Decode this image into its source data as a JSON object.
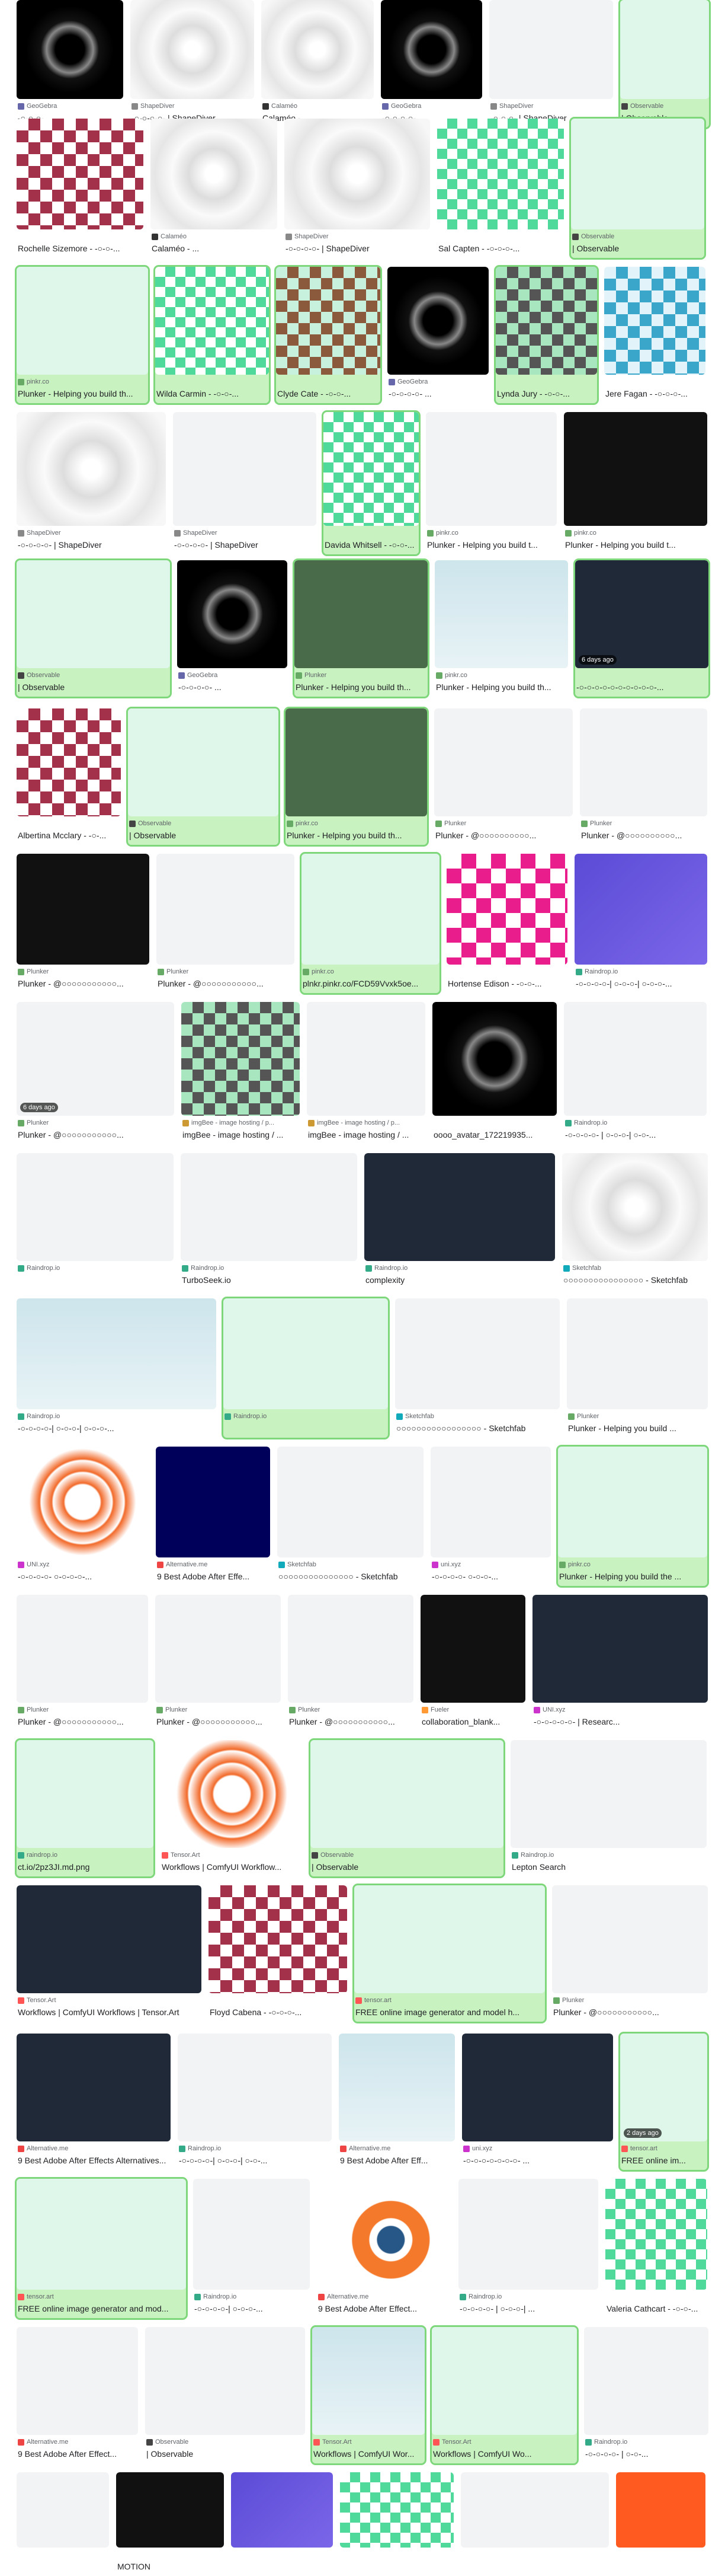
{
  "colors": {
    "selected_bg": "#c8f2c0",
    "selected_border": "#7ed77a",
    "text": "#202124",
    "muted": "#5f6368"
  },
  "rows": [
    {
      "cards": [
        {
          "src": "GeoGebra",
          "title": "-○-○-○- ...",
          "fav": "#66a",
          "cls": "raddk",
          "sel": false
        },
        {
          "src": "ShapeDiver",
          "title": "-○-○-○-○- | ShapeDiver",
          "fav": "#888",
          "cls": "rad",
          "sel": false
        },
        {
          "src": "Calaméo",
          "title": "Calaméo - ...",
          "fav": "#333",
          "cls": "rad",
          "sel": false
        },
        {
          "src": "GeoGebra",
          "title": "-○-○-○-○- ...",
          "fav": "#66a",
          "cls": "raddk",
          "sel": false
        },
        {
          "src": "ShapeDiver",
          "title": "-○-○-○- | ShapeDiver",
          "fav": "#888",
          "cls": "lt",
          "sel": false
        },
        {
          "src": "Observable",
          "title": "| Observable",
          "fav": "#444",
          "cls": "mint",
          "sel": true
        }
      ]
    },
    {
      "cards": [
        {
          "src": "",
          "title": "Rochelle Sizemore - -○-○-...",
          "fav": "",
          "cls": "quilt-red",
          "sel": false
        },
        {
          "src": "Calaméo",
          "title": "Calaméo - ...",
          "fav": "#333",
          "cls": "rad",
          "sel": false
        },
        {
          "src": "ShapeDiver",
          "title": "-○-○-○-○- | ShapeDiver",
          "fav": "#888",
          "cls": "rad",
          "sel": false
        },
        {
          "src": "",
          "title": "Sal Capten - -○-○-○-...",
          "fav": "",
          "cls": "quilt-green",
          "sel": false
        },
        {
          "src": "Observable",
          "title": "| Observable",
          "fav": "#444",
          "cls": "mint",
          "sel": true
        }
      ]
    },
    {
      "cards": [
        {
          "src": "pinkr.co",
          "title": "Plunker - Helping you build th...",
          "fav": "#6a6",
          "cls": "mint",
          "sel": true
        },
        {
          "src": "",
          "title": "Wilda Carmin - -○-○-...",
          "fav": "",
          "cls": "quilt-green",
          "sel": true
        },
        {
          "src": "",
          "title": "Clyde Cate - -○-○-...",
          "fav": "",
          "cls": "quilt-brown",
          "sel": true
        },
        {
          "src": "GeoGebra",
          "title": "-○-○-○-○- ...",
          "fav": "#66a",
          "cls": "raddk",
          "sel": false
        },
        {
          "src": "",
          "title": "Lynda Jury - -○-○-...",
          "fav": "",
          "cls": "quilt-grey",
          "sel": true
        },
        {
          "src": "",
          "title": "Jere Fagan - -○-○-○-...",
          "fav": "",
          "cls": "quilt-teal",
          "sel": false
        }
      ]
    },
    {
      "cards": [
        {
          "src": "ShapeDiver",
          "title": "-○-○-○-○- | ShapeDiver",
          "fav": "#888",
          "cls": "rad",
          "sel": false
        },
        {
          "src": "ShapeDiver",
          "title": "-○-○-○-○- | ShapeDiver",
          "fav": "#888",
          "cls": "lt",
          "sel": false
        },
        {
          "src": "",
          "title": "Davida Whitsell - -○-○-...",
          "fav": "",
          "cls": "quilt-green",
          "sel": true
        },
        {
          "src": "pinkr.co",
          "title": "Plunker - Helping you build t...",
          "fav": "#6a6",
          "cls": "lt",
          "sel": false
        },
        {
          "src": "pinkr.co",
          "title": "Plunker - Helping you build t...",
          "fav": "#6a6",
          "cls": "dk",
          "sel": false
        }
      ]
    },
    {
      "cards": [
        {
          "src": "Observable",
          "title": "| Observable",
          "fav": "#444",
          "cls": "mint",
          "sel": true
        },
        {
          "src": "GeoGebra",
          "title": "-○-○-○-○- ...",
          "fav": "#66a",
          "cls": "raddk",
          "sel": false
        },
        {
          "src": "Plunker",
          "title": "Plunker - Helping you build th...",
          "fav": "#6a6",
          "cls": "green-dk",
          "sel": true
        },
        {
          "src": "pinkr.co",
          "title": "Plunker - Helping you build th...",
          "fav": "#6a6",
          "cls": "sky",
          "sel": false
        },
        {
          "src": "",
          "title": "-○-○-○-○-○-○-○-○-○-○-...",
          "fav": "",
          "cls": "navy",
          "sel": true,
          "ago": "6 days ago"
        }
      ]
    },
    {
      "cards": [
        {
          "src": "",
          "title": "Albertina Mcclary - -○-...",
          "fav": "",
          "cls": "quilt-red",
          "sel": false
        },
        {
          "src": "Observable",
          "title": "| Observable",
          "fav": "#444",
          "cls": "mint",
          "sel": true
        },
        {
          "src": "pinkr.co",
          "title": "Plunker - Helping you build th...",
          "fav": "#6a6",
          "cls": "green-dk",
          "sel": true
        },
        {
          "src": "Plunker",
          "title": "Plunker - @○○○○○○○○○○...",
          "fav": "#6a6",
          "cls": "lt",
          "sel": false
        },
        {
          "src": "Plunker",
          "title": "Plunker - @○○○○○○○○○○...",
          "fav": "#6a6",
          "cls": "lt",
          "sel": false
        }
      ]
    },
    {
      "cards": [
        {
          "src": "Plunker",
          "title": "Plunker - @○○○○○○○○○○○...",
          "fav": "#6a6",
          "cls": "dk",
          "sel": false
        },
        {
          "src": "Plunker",
          "title": "Plunker - @○○○○○○○○○○○...",
          "fav": "#6a6",
          "cls": "lt",
          "sel": false
        },
        {
          "src": "pinkr.co",
          "title": "plnkr.pinkr.co/FCD59Vvxk5oe...",
          "fav": "#6a6",
          "cls": "mint",
          "sel": true
        },
        {
          "src": "",
          "title": "Hortense Edison - -○-○-...",
          "fav": "",
          "cls": "magenta",
          "sel": false
        },
        {
          "src": "Raindrop.io",
          "title": "-○-○-○-○-| ○-○-○-| ○-○-○-...",
          "fav": "#3a8",
          "cls": "purple",
          "sel": false
        }
      ]
    },
    {
      "cards": [
        {
          "src": "Plunker",
          "title": "Plunker - @○○○○○○○○○○○...",
          "fav": "#6a6",
          "cls": "lt",
          "sel": false,
          "ago": "6 days ago"
        },
        {
          "src": "imgBee - image hosting / p...",
          "title": "imgBee - image hosting / ...",
          "fav": "#c93",
          "cls": "quilt-grey",
          "sel": false
        },
        {
          "src": "imgBee - image hosting / p...",
          "title": "imgBee - image hosting / ...",
          "fav": "#c93",
          "cls": "lt",
          "sel": false
        },
        {
          "src": "",
          "title": "oooo_avatar_172219935...",
          "fav": "",
          "cls": "raddk",
          "sel": false
        },
        {
          "src": "Raindrop.io",
          "title": "-○-○-○-○- | ○-○-○-| ○-○-...",
          "fav": "#3a8",
          "cls": "lt",
          "sel": false
        }
      ]
    },
    {
      "cards": [
        {
          "src": "Raindrop.io",
          "title": "",
          "fav": "#3a8",
          "cls": "lt",
          "sel": false
        },
        {
          "src": "Raindrop.io",
          "title": "TurboSeek.io",
          "fav": "#3a8",
          "cls": "lt",
          "sel": false
        },
        {
          "src": "Raindrop.io",
          "title": "complexity",
          "fav": "#3a8",
          "cls": "navy",
          "sel": false
        },
        {
          "src": "Sketchfab",
          "title": "○○○○○○○○○○○○○○○○ - Sketchfab",
          "fav": "#1ab",
          "cls": "rad",
          "sel": false
        }
      ]
    },
    {
      "cards": [
        {
          "src": "Raindrop.io",
          "title": "-○-○-○-○-| ○-○-○-| ○-○-○-...",
          "fav": "#3a8",
          "cls": "sky",
          "sel": false
        },
        {
          "src": "Raindrop.io",
          "title": "",
          "fav": "#3a8",
          "cls": "mint",
          "sel": true
        },
        {
          "src": "Sketchfab",
          "title": "○○○○○○○○○○○○○○○○○ - Sketchfab",
          "fav": "#1ab",
          "cls": "lt",
          "sel": false
        },
        {
          "src": "Plunker",
          "title": "Plunker - Helping you build ...",
          "fav": "#6a6",
          "cls": "lt",
          "sel": false
        }
      ]
    },
    {
      "cards": [
        {
          "src": "UNI.xyz",
          "title": "-○-○-○-○- ○-○-○-○-...",
          "fav": "#c3c",
          "cls": "orange",
          "sel": false
        },
        {
          "src": "Alternative.me",
          "title": "9 Best Adobe After Effe...",
          "fav": "#e44",
          "cls": "ae",
          "sel": false
        },
        {
          "src": "Sketchfab",
          "title": "○○○○○○○○○○○○○○○ - Sketchfab",
          "fav": "#1ab",
          "cls": "lt",
          "sel": false
        },
        {
          "src": "uni.xyz",
          "title": "-○-○-○-○- ○-○-○-...",
          "fav": "#c3c",
          "cls": "lt",
          "sel": false
        },
        {
          "src": "pinkr.co",
          "title": "Plunker - Helping you build the ...",
          "fav": "#6a6",
          "cls": "mint",
          "sel": true
        }
      ]
    },
    {
      "cards": [
        {
          "src": "Plunker",
          "title": "Plunker - @○○○○○○○○○○○...",
          "fav": "#6a6",
          "cls": "lt",
          "sel": false
        },
        {
          "src": "Plunker",
          "title": "Plunker - @○○○○○○○○○○○...",
          "fav": "#6a6",
          "cls": "lt",
          "sel": false
        },
        {
          "src": "Plunker",
          "title": "Plunker - @○○○○○○○○○○○...",
          "fav": "#6a6",
          "cls": "lt",
          "sel": false
        },
        {
          "src": "Fueler",
          "title": "collaboration_blank...",
          "fav": "#f93",
          "cls": "dk",
          "sel": false
        },
        {
          "src": "UNI.xyz",
          "title": "-○-○-○-○-○- | Researc...",
          "fav": "#c3c",
          "cls": "navy",
          "sel": false
        }
      ]
    },
    {
      "cards": [
        {
          "src": "raindrop.io",
          "title": "ct.io/2pz3JI.md.png",
          "fav": "#3a8",
          "cls": "mint",
          "sel": true
        },
        {
          "src": "Tensor.Art",
          "title": "Workflows | ComfyUI Workflow...",
          "fav": "#f55",
          "cls": "orange",
          "sel": false
        },
        {
          "src": "Observable",
          "title": "| Observable",
          "fav": "#444",
          "cls": "mint",
          "sel": true
        },
        {
          "src": "Raindrop.io",
          "title": "Lepton Search",
          "fav": "#3a8",
          "cls": "lt",
          "sel": false
        }
      ]
    },
    {
      "cards": [
        {
          "src": "Tensor.Art",
          "title": "Workflows | ComfyUI Workflows | Tensor.Art",
          "fav": "#f55",
          "cls": "navy",
          "sel": false
        },
        {
          "src": "",
          "title": "Floyd Cabena - -○-○-○-...",
          "fav": "",
          "cls": "quilt-red",
          "sel": false
        },
        {
          "src": "tensor.art",
          "title": "FREE online image generator and model h...",
          "fav": "#f55",
          "cls": "mint",
          "sel": true
        },
        {
          "src": "Plunker",
          "title": "Plunker - @○○○○○○○○○○○...",
          "fav": "#6a6",
          "cls": "lt",
          "sel": false
        }
      ]
    },
    {
      "cards": [
        {
          "src": "Alternative.me",
          "title": "9 Best Adobe After Effects Alternatives...",
          "fav": "#e44",
          "cls": "navy",
          "sel": false
        },
        {
          "src": "Raindrop.io",
          "title": "-○-○-○-○-| ○-○-○-| ○-○-...",
          "fav": "#3a8",
          "cls": "lt",
          "sel": false
        },
        {
          "src": "Alternative.me",
          "title": "9 Best Adobe After Eff...",
          "fav": "#e44",
          "cls": "sky",
          "sel": false
        },
        {
          "src": "uni.xyz",
          "title": "-○-○-○-○-○-○-○- ...",
          "fav": "#c3c",
          "cls": "navy",
          "sel": false
        },
        {
          "src": "tensor.art",
          "title": "FREE online im...",
          "fav": "#f55",
          "cls": "mint",
          "sel": true,
          "ago": "2 days ago"
        }
      ]
    },
    {
      "cards": [
        {
          "src": "tensor.art",
          "title": "FREE online image generator and mod...",
          "fav": "#f55",
          "cls": "mint",
          "sel": true
        },
        {
          "src": "Raindrop.io",
          "title": "-○-○-○-○-| ○-○-○-...",
          "fav": "#3a8",
          "cls": "lt",
          "sel": false
        },
        {
          "src": "Alternative.me",
          "title": "9 Best Adobe After Effect...",
          "fav": "#e44",
          "cls": "blender",
          "sel": false
        },
        {
          "src": "Raindrop.io",
          "title": "-○-○-○-○- | ○-○-○-| ...",
          "fav": "#3a8",
          "cls": "lt",
          "sel": false
        },
        {
          "src": "",
          "title": "Valeria Cathcart - -○-○-...",
          "fav": "",
          "cls": "quilt-green",
          "sel": false
        }
      ]
    },
    {
      "cards": [
        {
          "src": "Alternative.me",
          "title": "9 Best Adobe After Effect...",
          "fav": "#e44",
          "cls": "lt",
          "sel": false
        },
        {
          "src": "Observable",
          "title": "| Observable",
          "fav": "#444",
          "cls": "lt",
          "sel": false
        },
        {
          "src": "Tensor.Art",
          "title": "Workflows | ComfyUI Wor...",
          "fav": "#f55",
          "cls": "sky",
          "sel": true
        },
        {
          "src": "Tensor.Art",
          "title": "Workflows | ComfyUI Wo...",
          "fav": "#f55",
          "cls": "mint",
          "sel": true
        },
        {
          "src": "Raindrop.io",
          "title": "-○-○-○-○- | ○-○-...",
          "fav": "#3a8",
          "cls": "lt",
          "sel": false
        }
      ]
    },
    {
      "cards": [
        {
          "src": "",
          "title": "",
          "fav": "",
          "cls": "lt",
          "sel": false
        },
        {
          "src": "",
          "title": "MOTION",
          "fav": "",
          "cls": "dk",
          "sel": false
        },
        {
          "src": "",
          "title": "",
          "fav": "",
          "cls": "purple",
          "sel": false
        },
        {
          "src": "",
          "title": "",
          "fav": "",
          "cls": "quilt-green",
          "sel": false
        },
        {
          "src": "",
          "title": "",
          "fav": "",
          "cls": "lt",
          "sel": false
        },
        {
          "src": "",
          "title": "",
          "fav": "",
          "cls": "flame",
          "sel": false
        }
      ]
    }
  ]
}
